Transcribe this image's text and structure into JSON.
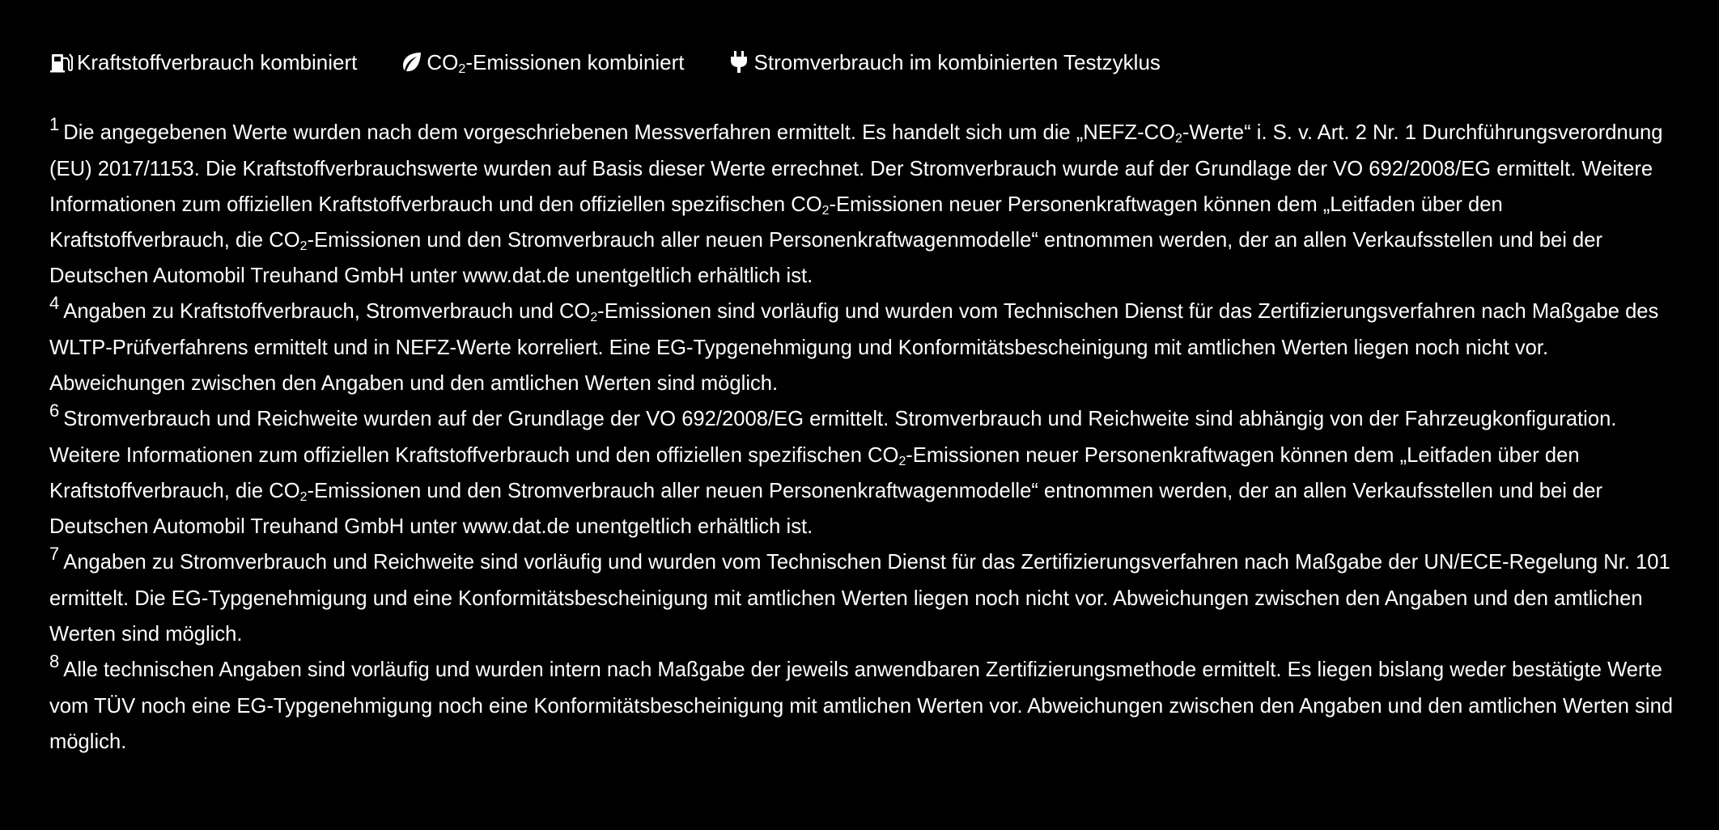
{
  "legend": {
    "fuel_label": "Kraftstoffverbrauch kombiniert",
    "co2_label_prefix": "CO",
    "co2_label_sub": "2",
    "co2_label_suffix": "-Emissionen kombiniert",
    "power_label": "Stromverbrauch im kombinierten Testzyklus",
    "icons": [
      "fuel-pump-icon",
      "leaf-icon",
      "plug-icon"
    ]
  },
  "notes": [
    {
      "num": "1",
      "parts": [
        "Die angegebenen Werte wurden nach dem vorgeschriebenen Messverfahren ermittelt. Es handelt sich um die „NEFZ-CO",
        "2",
        "-Werte“ i. S. v. Art. 2 Nr. 1 Durchführungsverordnung (EU) 2017/1153. Die Kraftstoffverbrauchswerte wurden auf Basis dieser Werte errechnet. Der Stromverbrauch wurde auf der Grundlage der VO 692/2008/EG ermittelt. Weitere Informationen zum offiziellen Kraftstoffverbrauch und den offiziellen spezifischen CO",
        "2",
        "-Emissionen neuer Personenkraftwagen können dem „Leitfaden über den Kraftstoffverbrauch, die CO",
        "2",
        "-Emissionen und den Stromverbrauch aller neuen Personenkraftwagenmodelle“ entnommen werden, der an allen Verkaufsstellen und bei der Deutschen Automobil Treuhand GmbH unter www.dat.de unentgeltlich erhältlich ist."
      ]
    },
    {
      "num": "4",
      "parts": [
        "Angaben zu Kraftstoffverbrauch, Stromverbrauch und CO",
        "2",
        "-Emissionen sind vorläufig und wurden vom Technischen Dienst für das Zertifizierungsverfahren nach Maßgabe des WLTP-Prüfverfahrens ermittelt und in NEFZ-Werte korreliert. Eine EG-Typgenehmigung und Konformitätsbescheinigung mit amtlichen Werten liegen noch nicht vor. Abweichungen zwischen den Angaben und den amtlichen Werten sind möglich."
      ]
    },
    {
      "num": "6",
      "parts": [
        "Stromverbrauch und Reichweite wurden auf der Grundlage der VO 692/2008/EG ermittelt. Stromverbrauch und Reichweite sind abhängig von der Fahrzeugkonfiguration. Weitere Informationen zum offiziellen Kraftstoffverbrauch und den offiziellen spezifischen CO",
        "2",
        "-Emissionen neuer Personenkraftwagen können dem „Leitfaden über den Kraftstoffverbrauch, die CO",
        "2",
        "-Emissionen und den Stromverbrauch aller neuen Personenkraftwagenmodelle“ entnommen werden, der an allen Verkaufsstellen und bei der Deutschen Automobil Treuhand GmbH unter www.dat.de unentgeltlich erhältlich ist."
      ]
    },
    {
      "num": "7",
      "parts": [
        "Angaben zu Stromverbrauch und Reichweite sind vorläufig und wurden vom Technischen Dienst für das Zertifizierungsverfahren nach Maßgabe der UN/ECE-Regelung Nr. 101 ermittelt. Die EG-Typgenehmigung und eine Konformitätsbescheinigung mit amtlichen Werten liegen noch nicht vor. Abweichungen zwischen den Angaben und den amtlichen Werten sind möglich."
      ]
    },
    {
      "num": "8",
      "parts": [
        "Alle technischen Angaben sind vorläufig und wurden intern nach Maßgabe der jeweils anwendbaren Zertifizierungsmethode ermittelt. Es liegen bislang weder bestätigte Werte vom TÜV noch eine EG-Typgenehmigung noch eine Konformitätsbescheinigung mit amtlichen Werten vor. Abweichungen zwischen den Angaben und den amtlichen Werten sind möglich."
      ]
    }
  ]
}
